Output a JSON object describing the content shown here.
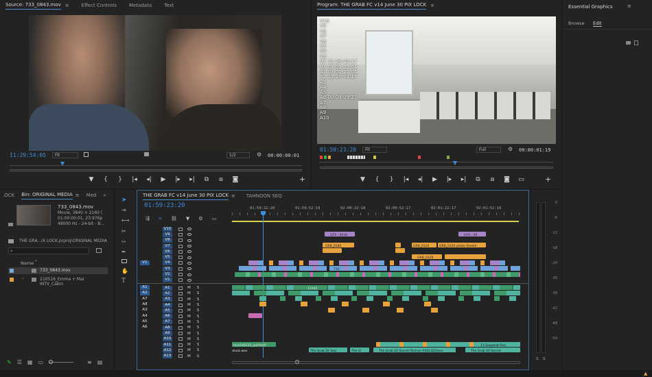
{
  "source_panel": {
    "tabs": [
      "Source: 733_0843.mov",
      "Effect Controls",
      "Metadata",
      "Text"
    ],
    "timecode": "11:29:54:05",
    "fit": "Fit",
    "resolution": "1/2",
    "duration": "00:00:00:01"
  },
  "program_panel": {
    "title": "Program: THE GRAB FC v14 June 30 PIX LOCK",
    "overlay_lines": [
      "V10",
      "V9",
      "V8",
      "V7",
      "V6",
      "V5",
      "V4",
      "V3",
      "V2  22:28:44:17",
      "V1  07:01:27:04",
      "A1  07:01:27:04",
      "A2  22:28:44:17",
      "A3",
      "A4",
      "A5",
      "A6  00:09:09:27",
      "A7",
      "A8",
      "A9",
      "A10"
    ],
    "timecode": "01:59:23:20",
    "fit": "Fit",
    "quality": "Full",
    "duration": "00:00:01:19"
  },
  "essential_graphics": {
    "title": "Essential Graphics",
    "tabs": [
      "Browse",
      "Edit"
    ]
  },
  "project_panel": {
    "tabs": [
      ".OCK",
      "Bin: ORIGINAL MEDIA",
      "Med"
    ],
    "clip_name": "733_0843.mov",
    "clip_info": [
      "Movie, 3840 × 2160 (",
      "01:00:00:01, 23.976p",
      "48000 Hz - 24-bit - B..."
    ],
    "path": "THE GRA...IX LOCK.prproj\\ORIGINAL MEDIA",
    "name_header": "Name",
    "items": [
      "733_0843.mov",
      "210516_Emma + Mal INTV_Cabin"
    ]
  },
  "timeline": {
    "tabs": [
      "THE GRAB FC v14 June 30 PIX LOCK",
      "TAHNOON SEQ"
    ],
    "timecode": "01:59:23:20",
    "ruler": [
      "01:59:22:20",
      "01:59:52:19",
      "02:00:22:18",
      "02:00:52:17",
      "02:01:22:17",
      "02:01:52:16"
    ],
    "video_tracks": [
      "V10",
      "V9",
      "V8",
      "V7",
      "V6",
      "V5",
      "V4",
      "V3",
      "V2",
      "V1"
    ],
    "audio_tracks": [
      "A1",
      "A2",
      "A3",
      "A4",
      "A5",
      "A6",
      "A7",
      "A8",
      "A9",
      "A10",
      "A11",
      "A12",
      "A13"
    ],
    "source_video": "V1",
    "source_audio": [
      "A1",
      "A2",
      "A7",
      "A8",
      "A3",
      "A4",
      "A5",
      "A6"
    ],
    "clip_labels": [
      "GFX - 0030",
      "GFX - 00",
      "GRB_0180",
      "GRB_0120",
      "GRB_0120  photo  Sheikh Tahnoon",
      "GRB_0120",
      "733",
      "11042",
      "The Grab 20 Seq",
      "The Gr",
      "The Grab 20 Secret Partner #001322mov",
      "The Grab 20 Secret",
      "mcs140123_perfect0 stuck.wav",
      "13 Suspend One"
    ]
  },
  "meter": {
    "scale": [
      "0",
      "-6",
      "-12",
      "-18",
      "-24",
      "-30",
      "-36",
      "-42",
      "-48",
      "-54"
    ],
    "solo": [
      "S",
      "S"
    ]
  },
  "colors": {
    "accent": "#3d8fe0",
    "clip_purple": "#a883c8",
    "clip_orange": "#e8a23d",
    "clip_green": "#3f9a6a",
    "clip_teal": "#4fb3a0",
    "clip_pink": "#c86bb4"
  }
}
